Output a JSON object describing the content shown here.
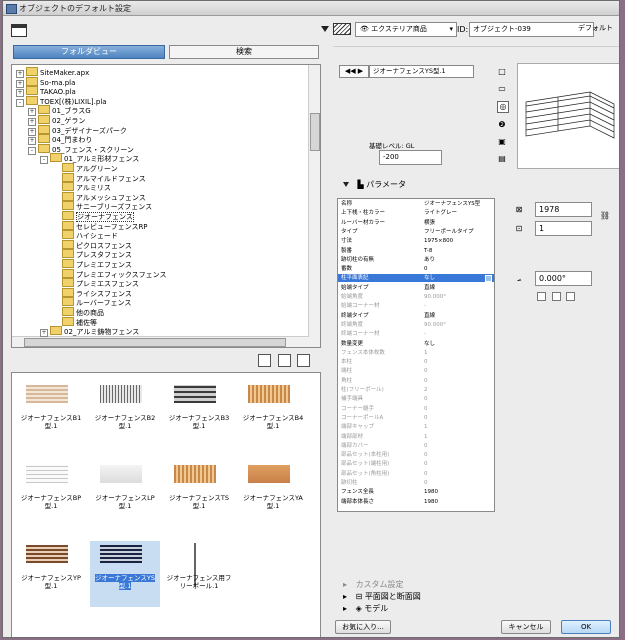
{
  "window": {
    "title": "オブジェクトのデフォルト設定"
  },
  "left": {
    "tabs": {
      "folder_view": "フォルダビュー",
      "search": "検索"
    },
    "tree": [
      {
        "label": "SiteMaker.apx",
        "depth": 0,
        "exp": "+"
      },
      {
        "label": "So-ma.pla",
        "depth": 0,
        "exp": "+"
      },
      {
        "label": "TAKAO.pla",
        "depth": 0,
        "exp": "+"
      },
      {
        "label": "TOEX[(株)LIXIL].pla",
        "depth": 0,
        "exp": "-"
      },
      {
        "label": "01_ブラスG",
        "depth": 1,
        "exp": "+"
      },
      {
        "label": "02_ゲラン",
        "depth": 1,
        "exp": "+"
      },
      {
        "label": "03_デザイナーズパーク",
        "depth": 1,
        "exp": "+"
      },
      {
        "label": "04_門まわり",
        "depth": 1,
        "exp": "+"
      },
      {
        "label": "05_フェンス・スクリーン",
        "depth": 1,
        "exp": "-"
      },
      {
        "label": "01_アルミ形材フェンス",
        "depth": 2,
        "exp": "-"
      },
      {
        "label": "アルグリーン",
        "depth": 3,
        "exp": ""
      },
      {
        "label": "アルマイルドフェンス",
        "depth": 3,
        "exp": ""
      },
      {
        "label": "アルミリス",
        "depth": 3,
        "exp": ""
      },
      {
        "label": "アルメッシュフェンス",
        "depth": 3,
        "exp": ""
      },
      {
        "label": "サニーブリーズフェンス",
        "depth": 3,
        "exp": ""
      },
      {
        "label": "ジオーナフェンス",
        "depth": 3,
        "exp": "",
        "selected": true
      },
      {
        "label": "セレビューフェンスRP",
        "depth": 3,
        "exp": ""
      },
      {
        "label": "ハイシェード",
        "depth": 3,
        "exp": ""
      },
      {
        "label": "ピクロスフェンス",
        "depth": 3,
        "exp": ""
      },
      {
        "label": "プレスタフェンス",
        "depth": 3,
        "exp": ""
      },
      {
        "label": "プレミエフェンス",
        "depth": 3,
        "exp": ""
      },
      {
        "label": "プレミエフィックスフェンス",
        "depth": 3,
        "exp": ""
      },
      {
        "label": "プレミエスフェンス",
        "depth": 3,
        "exp": ""
      },
      {
        "label": "ライシスフェンス",
        "depth": 3,
        "exp": ""
      },
      {
        "label": "ルーバーフェンス",
        "depth": 3,
        "exp": ""
      },
      {
        "label": "他の商品",
        "depth": 3,
        "exp": ""
      },
      {
        "label": "補佐等",
        "depth": 3,
        "exp": ""
      },
      {
        "label": "02_アルミ鋳物フェンス",
        "depth": 2,
        "exp": "+"
      }
    ],
    "thumbs": [
      {
        "caption": "ジオーナフェンスB1型.1",
        "pattern": "hstripe-tan",
        "selected": false
      },
      {
        "caption": "ジオーナフェンスB2型.1",
        "pattern": "vstripe-gray",
        "selected": false
      },
      {
        "caption": "ジオーナフェンスB3型.1",
        "pattern": "hstripe-dark",
        "selected": false
      },
      {
        "caption": "ジオーナフェンスB4型.1",
        "pattern": "vstripe-wood",
        "selected": false
      },
      {
        "caption": "ジオーナフェンスBP型.1",
        "pattern": "hstripe-white",
        "selected": false
      },
      {
        "caption": "ジオーナフェンスLP型.1",
        "pattern": "plain-white",
        "selected": false
      },
      {
        "caption": "ジオーナフェンスTS型.1",
        "pattern": "vstripe-wood",
        "selected": false
      },
      {
        "caption": "ジオーナフェンスYA型.1",
        "pattern": "plain-wood",
        "selected": false
      },
      {
        "caption": "ジオーナフェンスYP型.1",
        "pattern": "hstripe-brown",
        "selected": false
      },
      {
        "caption": "ジオーナフェンスYS型.1",
        "pattern": "hstripe-navy",
        "selected": true
      },
      {
        "caption": "ジオーナフェンス用フリーポール.1",
        "pattern": "pole",
        "selected": false
      }
    ]
  },
  "right": {
    "layer_combo": "エクステリア商品",
    "id_label": "ID:",
    "id_value": "オブジェクト-039",
    "default_label": "デフォルト",
    "nav_arrows": "◀◀ ▶",
    "object_name": "ジオーナフェンスYS型.1",
    "level_label": "基礎レベル: GL",
    "level_value": "-200",
    "params_title": "パラメータ",
    "width_value": "1978",
    "height_value": "1",
    "angle_value": "0.000°",
    "params": [
      {
        "name": "名称",
        "value": "ジオーナフェンスYS型",
        "state": "normal"
      },
      {
        "name": "上下桟・柱カラー",
        "value": "ライトグレー",
        "state": "normal"
      },
      {
        "name": "ルーバー材カラー",
        "value": "横張",
        "state": "normal"
      },
      {
        "name": "タイプ",
        "value": "フリーポールタイプ",
        "state": "normal"
      },
      {
        "name": "寸法",
        "value": "1975×800",
        "state": "normal"
      },
      {
        "name": "製番",
        "value": "T-8",
        "state": "normal"
      },
      {
        "name": "跡切柱の有無",
        "value": "あり",
        "state": "normal"
      },
      {
        "name": "番数",
        "value": "0",
        "state": "normal"
      },
      {
        "name": "柱平面表記",
        "value": "なし",
        "state": "highlight"
      },
      {
        "name": "始端タイプ",
        "value": "直線",
        "state": "normal"
      },
      {
        "name": "始端角度",
        "value": "90.000°",
        "state": "dim"
      },
      {
        "name": "始端コーナー材",
        "value": "-",
        "state": "dim"
      },
      {
        "name": "終端タイプ",
        "value": "直線",
        "state": "normal"
      },
      {
        "name": "終端角度",
        "value": "90.000°",
        "state": "dim"
      },
      {
        "name": "終端コーナー材",
        "value": "-",
        "state": "dim"
      },
      {
        "name": "数量変更",
        "value": "なし",
        "state": "normal"
      },
      {
        "name": "フェンス本体枚数",
        "value": "1",
        "state": "dim"
      },
      {
        "name": "本柱",
        "value": "0",
        "state": "dim"
      },
      {
        "name": "端柱",
        "value": "0",
        "state": "dim"
      },
      {
        "name": "角柱",
        "value": "0",
        "state": "dim"
      },
      {
        "name": "柱(フリーポール)",
        "value": "2",
        "state": "dim"
      },
      {
        "name": "補手端具",
        "value": "0",
        "state": "dim"
      },
      {
        "name": "コーナー継手",
        "value": "0",
        "state": "dim"
      },
      {
        "name": "コーナーポールA",
        "value": "0",
        "state": "dim"
      },
      {
        "name": "端部キャップ",
        "value": "1",
        "state": "dim"
      },
      {
        "name": "端部部材",
        "value": "1",
        "state": "dim"
      },
      {
        "name": "端部カバー",
        "value": "0",
        "state": "dim"
      },
      {
        "name": "部品セット(本柱用)",
        "value": "0",
        "state": "dim"
      },
      {
        "name": "部品セット(端柱用)",
        "value": "0",
        "state": "dim"
      },
      {
        "name": "部品セット(角柱用)",
        "value": "0",
        "state": "dim"
      },
      {
        "name": "跡切柱",
        "value": "0",
        "state": "dim"
      },
      {
        "name": "フェンス全長",
        "value": "1980",
        "state": "normal"
      },
      {
        "name": "端部本体長さ",
        "value": "1980",
        "state": "normal"
      }
    ],
    "sections": {
      "custom": "カスタム設定",
      "plan": "平面図と断面図",
      "model": "モデル"
    },
    "buttons": {
      "favorites": "お気に入り...",
      "cancel": "キャンセル",
      "ok": "OK"
    }
  }
}
